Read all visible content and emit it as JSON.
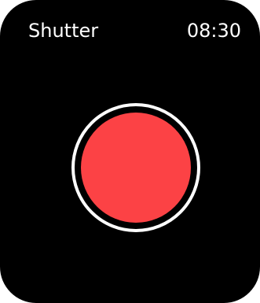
{
  "header": {
    "title": "Shutter",
    "time": "08:30"
  },
  "shutter_button": {
    "icon": "record-circle-icon",
    "fill_color": "#fc4245",
    "ring_color": "#ffffff"
  },
  "screen": {
    "background_color": "#000000"
  }
}
